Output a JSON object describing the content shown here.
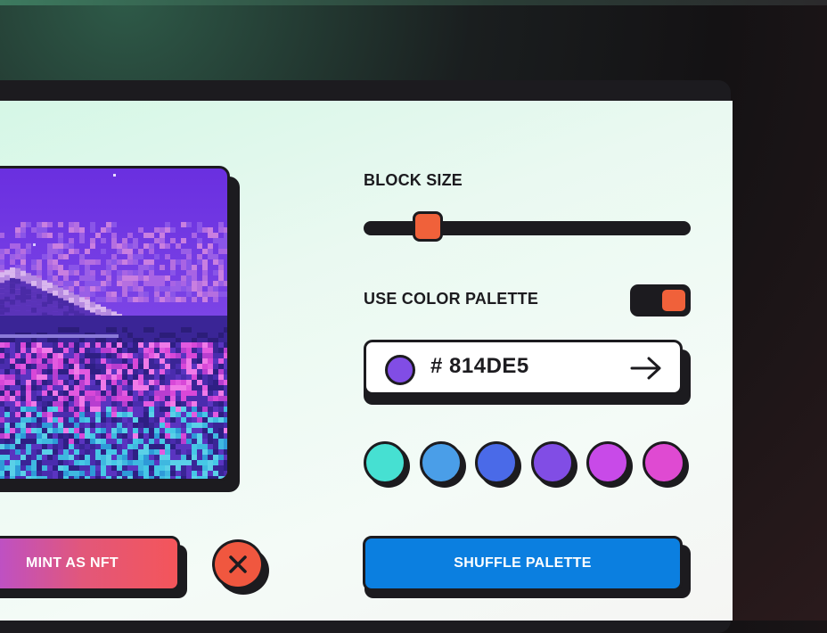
{
  "controls": {
    "block_size_label": "BLOCK SIZE",
    "block_size_value": 0.18,
    "color_palette_label": "USE COLOR PALETTE",
    "color_palette_enabled": true,
    "hex_prefix": "#",
    "hex_value": "814DE5",
    "hex_color": "#814DE5"
  },
  "palette": [
    "#46e0d2",
    "#4a9ee8",
    "#4a6ae8",
    "#814de5",
    "#c84ae8",
    "#df4ad2"
  ],
  "buttons": {
    "mint_label": "MINT AS NFT",
    "shuffle_label": "SHUFFLE PALETTE"
  },
  "colors": {
    "accent": "#f0613a",
    "dark": "#1c1b1f",
    "primary_button": "#0b7fe0"
  }
}
